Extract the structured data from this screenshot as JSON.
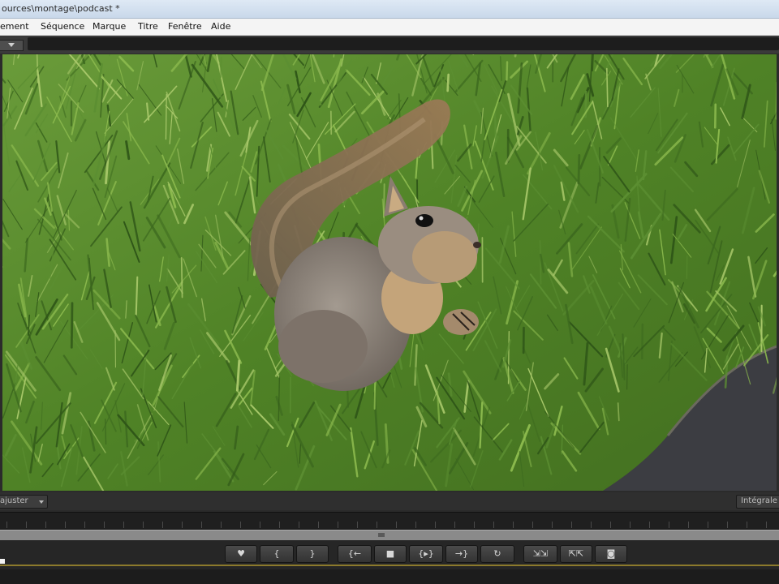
{
  "window": {
    "title": "ources\\montage\\podcast *"
  },
  "menu": [
    "ement",
    "Séquence",
    "Marque",
    "Titre",
    "Fenêtre",
    "Aide"
  ],
  "monitor": {
    "subject": "squirrel on grass",
    "colors": {
      "grass_dark": "#3d6a1f",
      "grass_mid": "#5c8f32",
      "grass_light": "#8cba4e",
      "fur_grey": "#8a8078",
      "fur_tan": "#b89a72",
      "path": "#3e3f44"
    }
  },
  "controls": {
    "view_dropdown": "ajuster",
    "right_button": "Intégrale"
  },
  "transport": {
    "buttons": [
      {
        "name": "add-marker-button",
        "icon": "♥"
      },
      {
        "name": "mark-in-button",
        "icon": "{"
      },
      {
        "name": "mark-out-button",
        "icon": "}"
      },
      {
        "name": "go-to-in-button",
        "icon": "{←"
      },
      {
        "name": "stop-button",
        "icon": "■"
      },
      {
        "name": "play-in-to-out-button",
        "icon": "{▸}"
      },
      {
        "name": "go-to-out-button",
        "icon": "→}"
      },
      {
        "name": "loop-button",
        "icon": "↻"
      },
      {
        "name": "insert-button",
        "icon": "⇲⇲"
      },
      {
        "name": "overlay-button",
        "icon": "⇱⇱"
      },
      {
        "name": "export-frame-button",
        "icon": "◙"
      }
    ]
  }
}
